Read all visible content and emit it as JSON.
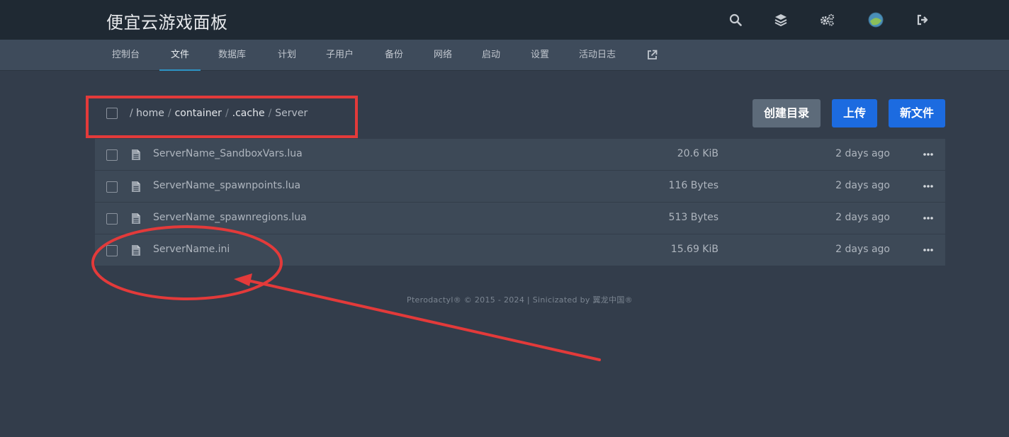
{
  "header": {
    "brand": "便宜云游戏面板",
    "icons": [
      "search-icon",
      "layers-icon",
      "gears-icon",
      "avatar-icon",
      "sign-out-icon"
    ]
  },
  "nav": {
    "items": [
      "控制台",
      "文件",
      "数据库",
      "计划",
      "子用户",
      "备份",
      "网络",
      "启动",
      "设置",
      "活动日志"
    ],
    "active": "文件",
    "external_icon": "external-link-icon"
  },
  "breadcrumb": {
    "root": "/",
    "segments": [
      "home",
      "container",
      ".cache",
      "Server"
    ]
  },
  "actions": {
    "create_dir": "创建目录",
    "upload": "上传",
    "new_file": "新文件"
  },
  "files": [
    {
      "name": "ServerName_SandboxVars.lua",
      "size": "20.6 KiB",
      "modified": "2 days ago"
    },
    {
      "name": "ServerName_spawnpoints.lua",
      "size": "116 Bytes",
      "modified": "2 days ago"
    },
    {
      "name": "ServerName_spawnregions.lua",
      "size": "513 Bytes",
      "modified": "2 days ago"
    },
    {
      "name": "ServerName.ini",
      "size": "15.69 KiB",
      "modified": "2 days ago"
    }
  ],
  "footer": "Pterodactyl® © 2015 - 2024 | Sinicizated by 翼龙中国®",
  "colors": {
    "background": "#333d4b",
    "topbar": "#1f2933",
    "subnav": "#3e4b5b",
    "row": "#3d4957",
    "accent_blue": "#1c6be0",
    "annotation_red": "#e33a3a"
  }
}
